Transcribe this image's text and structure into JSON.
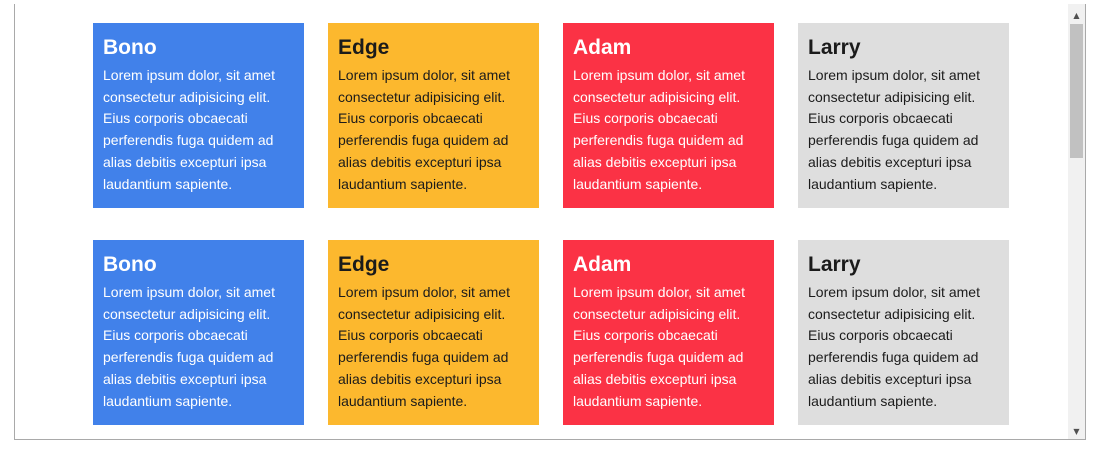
{
  "cards": [
    {
      "name": "Bono",
      "text": "Lorem ipsum dolor, sit amet consectetur adipisicing elit. Eius corporis obcaecati perferendis fuga quidem ad alias debitis excepturi ipsa laudantium sapiente.",
      "color": "#4181ea"
    },
    {
      "name": "Edge",
      "text": "Lorem ipsum dolor, sit amet consectetur adipisicing elit. Eius corporis obcaecati perferendis fuga quidem ad alias debitis excepturi ipsa laudantium sapiente.",
      "color": "#fcb82e"
    },
    {
      "name": "Adam",
      "text": "Lorem ipsum dolor, sit amet consectetur adipisicing elit. Eius corporis obcaecati perferendis fuga quidem ad alias debitis excepturi ipsa laudantium sapiente.",
      "color": "#fb3245"
    },
    {
      "name": "Larry",
      "text": "Lorem ipsum dolor, sit amet consectetur adipisicing elit. Eius corporis obcaecati perferendis fuga quidem ad alias debitis excepturi ipsa laudantium sapiente.",
      "color": "#dedede"
    },
    {
      "name": "Bono",
      "text": "Lorem ipsum dolor, sit amet consectetur adipisicing elit. Eius corporis obcaecati perferendis fuga quidem ad alias debitis excepturi ipsa laudantium sapiente.",
      "color": "#4181ea"
    },
    {
      "name": "Edge",
      "text": "Lorem ipsum dolor, sit amet consectetur adipisicing elit. Eius corporis obcaecati perferendis fuga quidem ad alias debitis excepturi ipsa laudantium sapiente.",
      "color": "#fcb82e"
    },
    {
      "name": "Adam",
      "text": "Lorem ipsum dolor, sit amet consectetur adipisicing elit. Eius corporis obcaecati perferendis fuga quidem ad alias debitis excepturi ipsa laudantium sapiente.",
      "color": "#fb3245"
    },
    {
      "name": "Larry",
      "text": "Lorem ipsum dolor, sit amet consectetur adipisicing elit. Eius corporis obcaecati perferendis fuga quidem ad alias debitis excepturi ipsa laudantium sapiente.",
      "color": "#dedede"
    }
  ],
  "scrollbar": {
    "up_icon": "chevron-up-icon",
    "down_icon": "chevron-down-icon"
  }
}
